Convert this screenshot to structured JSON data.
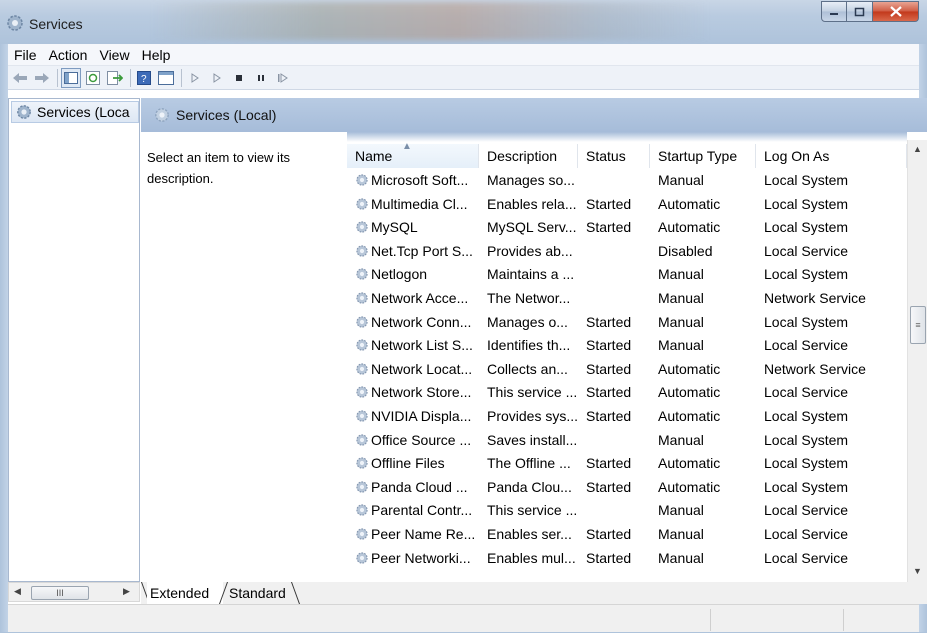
{
  "window": {
    "title": "Services"
  },
  "menu": [
    "File",
    "Action",
    "View",
    "Help"
  ],
  "tree": {
    "item": "Services (Loca"
  },
  "pane": {
    "title": "Services (Local)",
    "description_text": "Select an item to view its description."
  },
  "columns": [
    "Name",
    "Description",
    "Status",
    "Startup Type",
    "Log On As"
  ],
  "rows": [
    {
      "name": "Microsoft Soft...",
      "desc": "Manages so...",
      "status": "",
      "startup": "Manual",
      "logon": "Local System"
    },
    {
      "name": "Multimedia Cl...",
      "desc": "Enables rela...",
      "status": "Started",
      "startup": "Automatic",
      "logon": "Local System"
    },
    {
      "name": "MySQL",
      "desc": "MySQL Serv...",
      "status": "Started",
      "startup": "Automatic",
      "logon": "Local System"
    },
    {
      "name": "Net.Tcp Port S...",
      "desc": "Provides ab...",
      "status": "",
      "startup": "Disabled",
      "logon": "Local Service"
    },
    {
      "name": "Netlogon",
      "desc": "Maintains a ...",
      "status": "",
      "startup": "Manual",
      "logon": "Local System"
    },
    {
      "name": "Network Acce...",
      "desc": "The Networ...",
      "status": "",
      "startup": "Manual",
      "logon": "Network Service"
    },
    {
      "name": "Network Conn...",
      "desc": "Manages o...",
      "status": "Started",
      "startup": "Manual",
      "logon": "Local System"
    },
    {
      "name": "Network List S...",
      "desc": "Identifies th...",
      "status": "Started",
      "startup": "Manual",
      "logon": "Local Service"
    },
    {
      "name": "Network Locat...",
      "desc": "Collects an...",
      "status": "Started",
      "startup": "Automatic",
      "logon": "Network Service"
    },
    {
      "name": "Network Store...",
      "desc": "This service ...",
      "status": "Started",
      "startup": "Automatic",
      "logon": "Local Service"
    },
    {
      "name": "NVIDIA Displa...",
      "desc": "Provides sys...",
      "status": "Started",
      "startup": "Automatic",
      "logon": "Local System"
    },
    {
      "name": "Office Source ...",
      "desc": "Saves install...",
      "status": "",
      "startup": "Manual",
      "logon": "Local System"
    },
    {
      "name": "Offline Files",
      "desc": "The Offline ...",
      "status": "Started",
      "startup": "Automatic",
      "logon": "Local System"
    },
    {
      "name": "Panda Cloud ...",
      "desc": "Panda Clou...",
      "status": "Started",
      "startup": "Automatic",
      "logon": "Local System"
    },
    {
      "name": "Parental Contr...",
      "desc": "This service ...",
      "status": "",
      "startup": "Manual",
      "logon": "Local Service"
    },
    {
      "name": "Peer Name Re...",
      "desc": "Enables ser...",
      "status": "Started",
      "startup": "Manual",
      "logon": "Local Service"
    },
    {
      "name": "Peer Networki...",
      "desc": "Enables mul...",
      "status": "Started",
      "startup": "Manual",
      "logon": "Local Service"
    }
  ],
  "tabs": {
    "extended": "Extended",
    "standard": "Standard"
  },
  "scrollbar": {
    "hthumb_grip": "III",
    "vthumb_grip": "≡"
  },
  "icons": {
    "app": "gear-icon",
    "service": "gear-icon"
  },
  "colors": {
    "pane_header": "#a6bcd9",
    "close_button": "#c2381b"
  }
}
